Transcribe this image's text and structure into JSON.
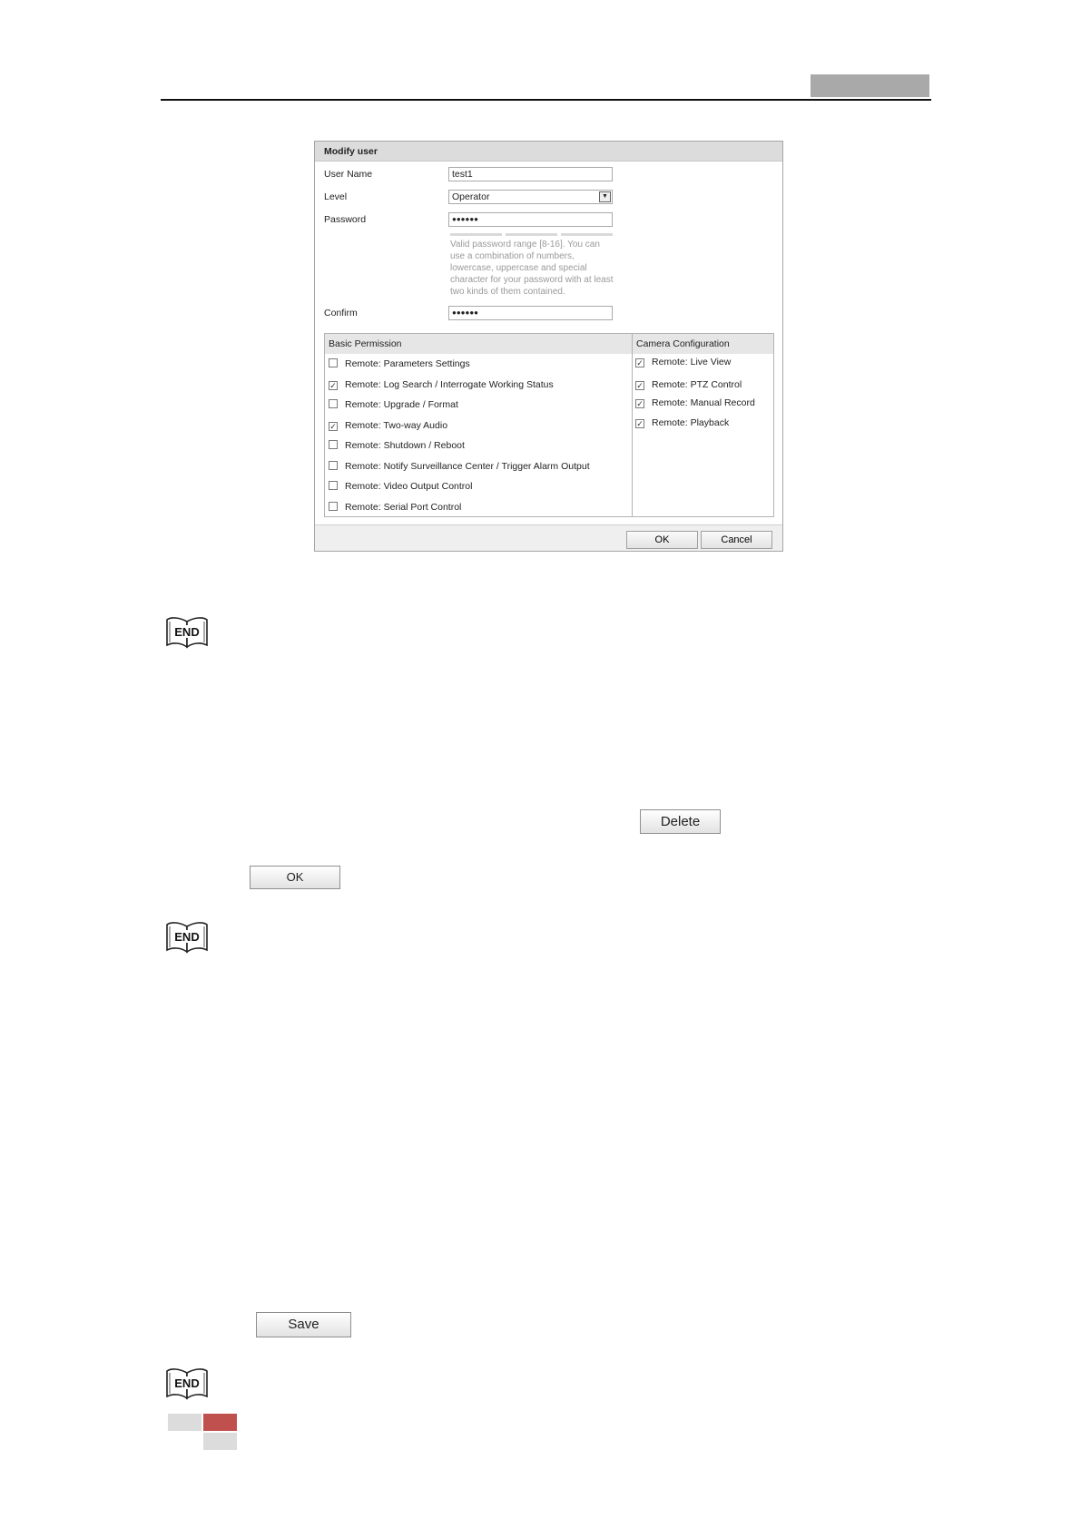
{
  "dialog": {
    "title": "Modify user",
    "fields": {
      "username_label": "User Name",
      "username_value": "test1",
      "level_label": "Level",
      "level_value": "Operator",
      "password_label": "Password",
      "password_value": "●●●●●●",
      "password_hint": "Valid password range [8-16]. You can use a combination of numbers, lowercase, uppercase and special character for your password with at least two kinds of them contained.",
      "confirm_label": "Confirm",
      "confirm_value": "●●●●●●"
    },
    "basic_permission": {
      "header": "Basic Permission",
      "items": [
        {
          "label": "Remote: Parameters Settings",
          "checked": false
        },
        {
          "label": "Remote: Log Search / Interrogate Working Status",
          "checked": true
        },
        {
          "label": "Remote: Upgrade / Format",
          "checked": false
        },
        {
          "label": "Remote: Two-way Audio",
          "checked": true
        },
        {
          "label": "Remote: Shutdown / Reboot",
          "checked": false
        },
        {
          "label": "Remote: Notify Surveillance Center / Trigger Alarm Output",
          "checked": false
        },
        {
          "label": "Remote: Video Output Control",
          "checked": false
        },
        {
          "label": "Remote: Serial Port Control",
          "checked": false
        }
      ]
    },
    "camera_configuration": {
      "header": "Camera Configuration",
      "items": [
        {
          "label": "Remote: Live View",
          "checked": true
        },
        {
          "label": "Remote: PTZ Control",
          "checked": true
        },
        {
          "label": "Remote: Manual Record",
          "checked": true
        },
        {
          "label": "Remote: Playback",
          "checked": true
        }
      ]
    },
    "ok_label": "OK",
    "cancel_label": "Cancel"
  },
  "end_label": "END",
  "buttons": {
    "delete_label": "Delete",
    "ok_label": "OK",
    "save_label": "Save"
  },
  "colors": {
    "header_tab": "#a9a9a9",
    "footer_red": "#c0504d",
    "footer_grey": "#dcdcdc"
  }
}
